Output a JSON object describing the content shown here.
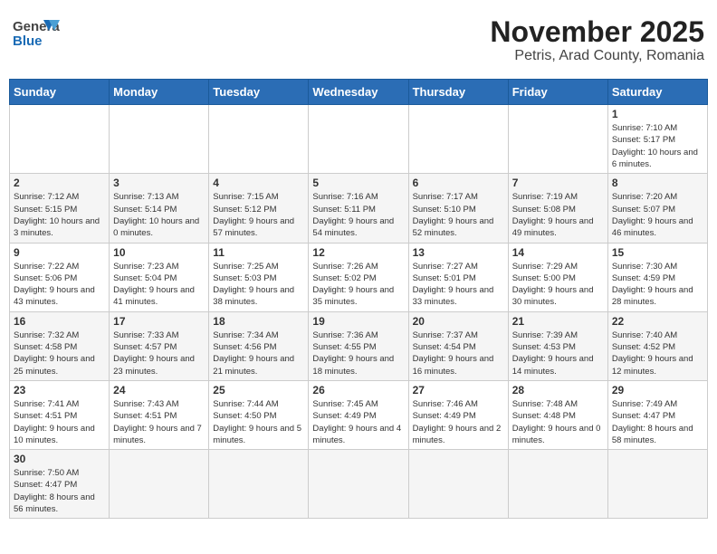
{
  "header": {
    "logo_general": "General",
    "logo_blue": "Blue",
    "month_title": "November 2025",
    "location": "Petris, Arad County, Romania"
  },
  "weekdays": [
    "Sunday",
    "Monday",
    "Tuesday",
    "Wednesday",
    "Thursday",
    "Friday",
    "Saturday"
  ],
  "weeks": [
    [
      null,
      null,
      null,
      null,
      null,
      null,
      {
        "day": "1",
        "sunrise": "7:10 AM",
        "sunset": "5:17 PM",
        "daylight": "10 hours and 6 minutes."
      }
    ],
    [
      {
        "day": "2",
        "sunrise": "7:12 AM",
        "sunset": "5:15 PM",
        "daylight": "10 hours and 3 minutes."
      },
      {
        "day": "3",
        "sunrise": "7:13 AM",
        "sunset": "5:14 PM",
        "daylight": "10 hours and 0 minutes."
      },
      {
        "day": "4",
        "sunrise": "7:15 AM",
        "sunset": "5:12 PM",
        "daylight": "9 hours and 57 minutes."
      },
      {
        "day": "5",
        "sunrise": "7:16 AM",
        "sunset": "5:11 PM",
        "daylight": "9 hours and 54 minutes."
      },
      {
        "day": "6",
        "sunrise": "7:17 AM",
        "sunset": "5:10 PM",
        "daylight": "9 hours and 52 minutes."
      },
      {
        "day": "7",
        "sunrise": "7:19 AM",
        "sunset": "5:08 PM",
        "daylight": "9 hours and 49 minutes."
      },
      {
        "day": "8",
        "sunrise": "7:20 AM",
        "sunset": "5:07 PM",
        "daylight": "9 hours and 46 minutes."
      }
    ],
    [
      {
        "day": "9",
        "sunrise": "7:22 AM",
        "sunset": "5:06 PM",
        "daylight": "9 hours and 43 minutes."
      },
      {
        "day": "10",
        "sunrise": "7:23 AM",
        "sunset": "5:04 PM",
        "daylight": "9 hours and 41 minutes."
      },
      {
        "day": "11",
        "sunrise": "7:25 AM",
        "sunset": "5:03 PM",
        "daylight": "9 hours and 38 minutes."
      },
      {
        "day": "12",
        "sunrise": "7:26 AM",
        "sunset": "5:02 PM",
        "daylight": "9 hours and 35 minutes."
      },
      {
        "day": "13",
        "sunrise": "7:27 AM",
        "sunset": "5:01 PM",
        "daylight": "9 hours and 33 minutes."
      },
      {
        "day": "14",
        "sunrise": "7:29 AM",
        "sunset": "5:00 PM",
        "daylight": "9 hours and 30 minutes."
      },
      {
        "day": "15",
        "sunrise": "7:30 AM",
        "sunset": "4:59 PM",
        "daylight": "9 hours and 28 minutes."
      }
    ],
    [
      {
        "day": "16",
        "sunrise": "7:32 AM",
        "sunset": "4:58 PM",
        "daylight": "9 hours and 25 minutes."
      },
      {
        "day": "17",
        "sunrise": "7:33 AM",
        "sunset": "4:57 PM",
        "daylight": "9 hours and 23 minutes."
      },
      {
        "day": "18",
        "sunrise": "7:34 AM",
        "sunset": "4:56 PM",
        "daylight": "9 hours and 21 minutes."
      },
      {
        "day": "19",
        "sunrise": "7:36 AM",
        "sunset": "4:55 PM",
        "daylight": "9 hours and 18 minutes."
      },
      {
        "day": "20",
        "sunrise": "7:37 AM",
        "sunset": "4:54 PM",
        "daylight": "9 hours and 16 minutes."
      },
      {
        "day": "21",
        "sunrise": "7:39 AM",
        "sunset": "4:53 PM",
        "daylight": "9 hours and 14 minutes."
      },
      {
        "day": "22",
        "sunrise": "7:40 AM",
        "sunset": "4:52 PM",
        "daylight": "9 hours and 12 minutes."
      }
    ],
    [
      {
        "day": "23",
        "sunrise": "7:41 AM",
        "sunset": "4:51 PM",
        "daylight": "9 hours and 10 minutes."
      },
      {
        "day": "24",
        "sunrise": "7:43 AM",
        "sunset": "4:51 PM",
        "daylight": "9 hours and 7 minutes."
      },
      {
        "day": "25",
        "sunrise": "7:44 AM",
        "sunset": "4:50 PM",
        "daylight": "9 hours and 5 minutes."
      },
      {
        "day": "26",
        "sunrise": "7:45 AM",
        "sunset": "4:49 PM",
        "daylight": "9 hours and 4 minutes."
      },
      {
        "day": "27",
        "sunrise": "7:46 AM",
        "sunset": "4:49 PM",
        "daylight": "9 hours and 2 minutes."
      },
      {
        "day": "28",
        "sunrise": "7:48 AM",
        "sunset": "4:48 PM",
        "daylight": "9 hours and 0 minutes."
      },
      {
        "day": "29",
        "sunrise": "7:49 AM",
        "sunset": "4:47 PM",
        "daylight": "8 hours and 58 minutes."
      }
    ],
    [
      {
        "day": "30",
        "sunrise": "7:50 AM",
        "sunset": "4:47 PM",
        "daylight": "8 hours and 56 minutes."
      },
      null,
      null,
      null,
      null,
      null,
      null
    ]
  ]
}
